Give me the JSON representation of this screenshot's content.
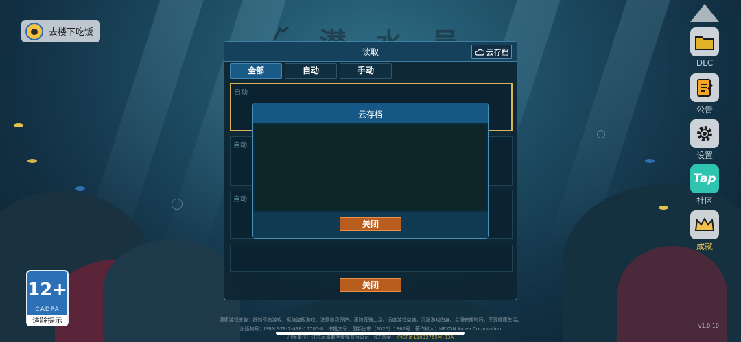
{
  "top_left": {
    "label": "去楼下吃饭",
    "avatar_icon": "character-avatar-icon"
  },
  "background": {
    "title": "潜 水 员"
  },
  "side_menu": {
    "items": [
      {
        "label": "DLC",
        "icon": "folder-icon"
      },
      {
        "label": "公告",
        "icon": "notice-icon"
      },
      {
        "label": "设置",
        "icon": "gear-icon"
      },
      {
        "label": "社区",
        "icon": "taptap-icon",
        "badge": "Tap"
      },
      {
        "label": "成就",
        "icon": "crown-icon"
      }
    ]
  },
  "load_dialog": {
    "title": "读取",
    "cloud_button": "云存档",
    "tabs": [
      "全部",
      "自动",
      "手动"
    ],
    "active_tab": "全部",
    "slots": [
      "自动",
      "自动",
      "自动"
    ],
    "close_label": "关闭"
  },
  "cloud_dialog": {
    "title": "云存档",
    "close_label": "关闭"
  },
  "age_rating": {
    "number": "12+",
    "org": "CADPA",
    "label": "适龄提示"
  },
  "footer": {
    "line1": "健康游戏忠告：抵制不良游戏，拒绝盗版游戏。注意自我保护，谨防受骗上当。适度游戏益脑，沉迷游戏伤身。合理安排时间，享受健康生活。",
    "line2": "出版物号：ISBN 978-7-498-15705-8　审批文号：国新出审〔2025〕1862号　著作权人：NEXON Korea Corporation",
    "line3a": "出版单位：江苏凤凰数字传媒有限公司　ICP备案：",
    "line3b": "沪ICP备11033765号-83A"
  },
  "version": "v1.0.10",
  "colors": {
    "accent": "#175786",
    "button_orange": "#b95d1f",
    "selected_border": "#d9b35a"
  }
}
